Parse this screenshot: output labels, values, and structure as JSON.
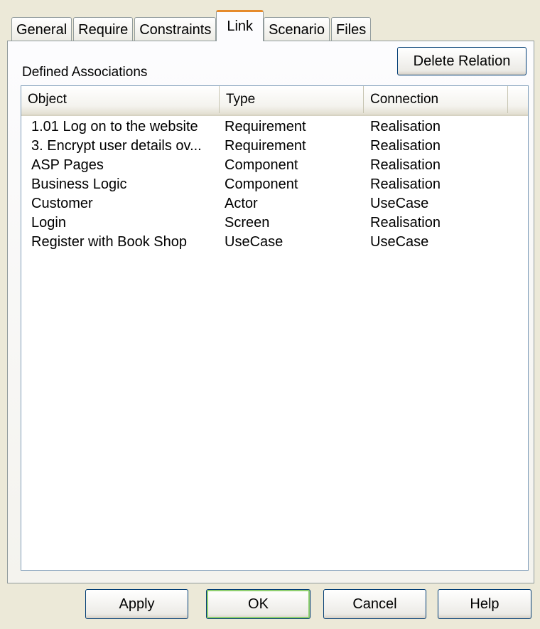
{
  "tabs": [
    {
      "label": "General"
    },
    {
      "label": "Require"
    },
    {
      "label": "Constraints"
    },
    {
      "label": "Link",
      "active": true
    },
    {
      "label": "Scenario"
    },
    {
      "label": "Files"
    }
  ],
  "page": {
    "defined_label": "Defined Associations",
    "delete_button": "Delete Relation"
  },
  "list": {
    "columns": [
      "Object",
      "Type",
      "Connection"
    ],
    "rows": [
      {
        "object": "1.01 Log on to the website",
        "type": "Requirement",
        "connection": "Realisation"
      },
      {
        "object": "3. Encrypt user details ov...",
        "type": "Requirement",
        "connection": "Realisation"
      },
      {
        "object": "ASP Pages",
        "type": "Component",
        "connection": "Realisation"
      },
      {
        "object": "Business Logic",
        "type": "Component",
        "connection": "Realisation"
      },
      {
        "object": "Customer",
        "type": "Actor",
        "connection": "UseCase"
      },
      {
        "object": "Login",
        "type": "Screen",
        "connection": "Realisation"
      },
      {
        "object": "Register with Book Shop",
        "type": "UseCase",
        "connection": "UseCase"
      }
    ]
  },
  "buttons": {
    "apply": "Apply",
    "ok": "OK",
    "cancel": "Cancel",
    "help": "Help"
  },
  "colors": {
    "dialog_bg": "#ece9d8",
    "active_tab_accent": "#e68b2c",
    "button_border": "#003c74",
    "list_border": "#7f9db9"
  }
}
